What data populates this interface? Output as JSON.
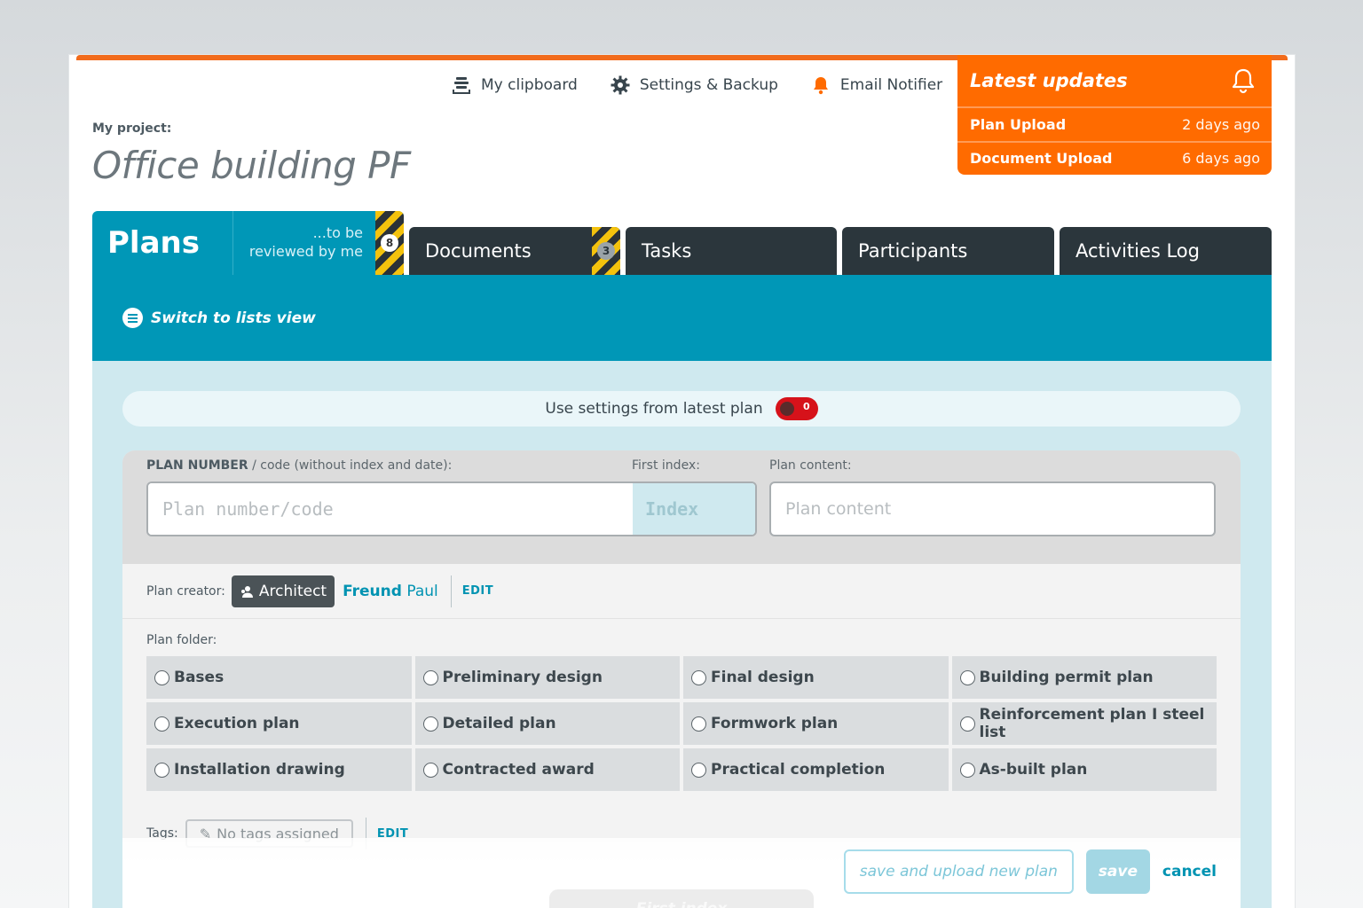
{
  "top_links": {
    "clipboard": "My clipboard",
    "settings": "Settings & Backup",
    "notifier": "Email Notifier"
  },
  "updates": {
    "title": "Latest updates",
    "items": [
      {
        "name": "Plan Upload",
        "time": "2 days ago"
      },
      {
        "name": "Document Upload",
        "time": "6 days ago"
      }
    ]
  },
  "project": {
    "label": "My project:",
    "title": "Office building PF"
  },
  "tabs": {
    "plans": "Plans",
    "plans_sub_line1": "...to be",
    "plans_sub_line2": "reviewed by me",
    "plans_count": "8",
    "documents": "Documents",
    "documents_count": "3",
    "tasks": "Tasks",
    "participants": "Participants",
    "activities": "Activities Log"
  },
  "switch_view": "Switch to lists view",
  "settings_bar": {
    "label": "Use settings from latest plan",
    "toggle_state": "0"
  },
  "form": {
    "plan_number_label_bold": "PLAN NUMBER",
    "plan_number_label_rest": " / code (without index and date):",
    "first_index_label": "First index:",
    "plan_content_label": "Plan content:",
    "plan_number_placeholder": "Plan number/code",
    "index_placeholder": "Index",
    "plan_content_placeholder": "Plan content",
    "creator_label": "Plan creator:",
    "creator_role": "Architect",
    "creator_first": "Freund",
    "creator_last": "Paul",
    "edit": "EDIT",
    "folder_label": "Plan folder:",
    "folders": [
      "Bases",
      "Preliminary design",
      "Final design",
      "Building permit plan",
      "Execution plan",
      "Detailed plan",
      "Formwork plan",
      "Reinforcement plan I steel list",
      "Installation drawing",
      "Contracted award",
      "Practical completion",
      "As-built plan"
    ],
    "tags_label": "Tags:",
    "tags_value": "No tags assigned",
    "tags_edit": "EDIT"
  },
  "actions": {
    "save_upload": "save and upload new plan",
    "save": "save",
    "cancel": "cancel",
    "ghost": "First index"
  },
  "colors": {
    "accent_orange": "#ff6b00",
    "teal": "#0097b7",
    "dark_tab": "#2b363c",
    "toggle_red": "#d6121a"
  }
}
